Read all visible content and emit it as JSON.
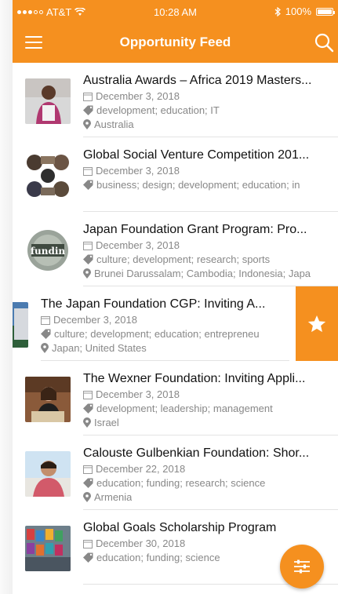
{
  "status_bar": {
    "carrier": "AT&T",
    "time": "10:28 AM",
    "battery": "100%",
    "battery_level": 1.0
  },
  "header": {
    "title": "Opportunity Feed",
    "menu_icon": "hamburger-icon",
    "search_icon": "search-icon"
  },
  "items": [
    {
      "title": "Australia Awards – Africa 2019 Masters...",
      "date": "December 3, 2018",
      "tags": "development; education; IT",
      "location": "Australia"
    },
    {
      "title": "Global Social Venture Competition 201...",
      "date": "December 3, 2018",
      "tags": "business; design; development; education; in",
      "location": ""
    },
    {
      "title": "Japan Foundation Grant Program: Pro...",
      "date": "December 3, 2018",
      "tags": "culture; development; research; sports",
      "location": "Brunei Darussalam; Cambodia; Indonesia; Japa"
    },
    {
      "title": "The Japan Foundation CGP: Inviting A...",
      "date": "December 3, 2018",
      "tags": "culture; development; education; entrepreneu",
      "location": "Japan; United States"
    },
    {
      "title": "The Wexner Foundation: Inviting Appli...",
      "date": "December 3, 2018",
      "tags": "development; leadership; management",
      "location": "Israel"
    },
    {
      "title": "Calouste Gulbenkian Foundation: Shor...",
      "date": "December 22, 2018",
      "tags": "education; funding; research; science",
      "location": "Armenia"
    },
    {
      "title": "Global Goals Scholarship Program",
      "date": "December 30, 2018",
      "tags": "education; funding; science",
      "location": ""
    }
  ],
  "thumb_text": "fundin",
  "colors": {
    "accent": "#f5901f",
    "meta": "#888888"
  },
  "icons": {
    "star": "star-icon",
    "filter": "filter-icon",
    "calendar": "calendar-icon",
    "tag": "tag-icon",
    "location": "location-pin-icon"
  }
}
